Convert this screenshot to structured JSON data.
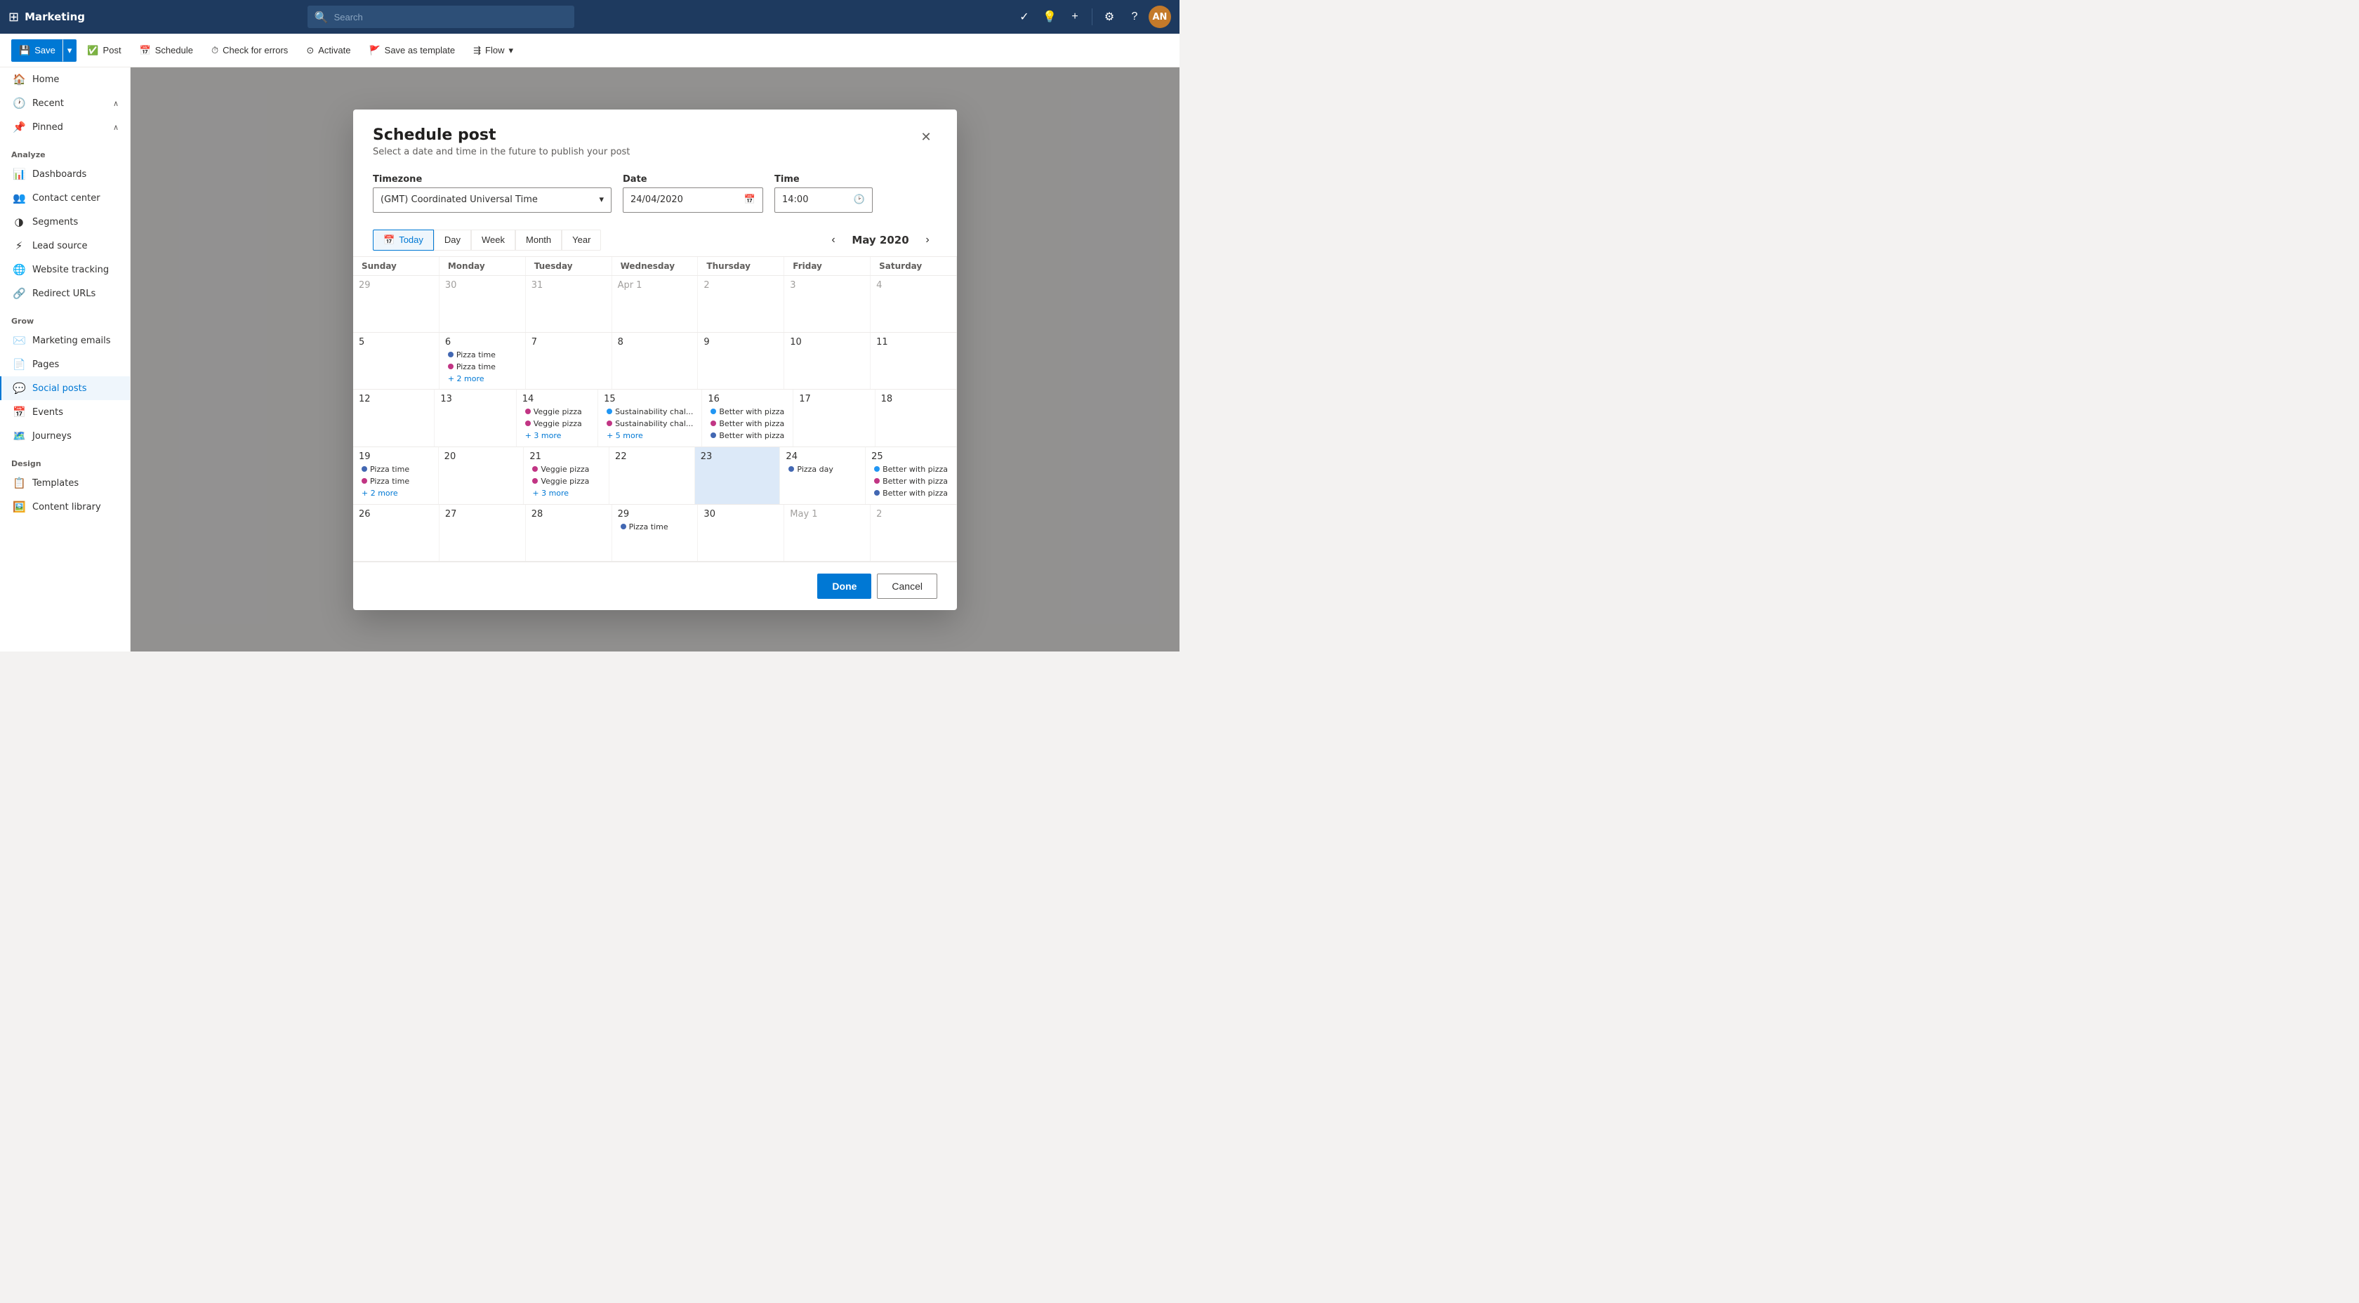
{
  "app": {
    "name": "Marketing",
    "search_placeholder": "Search"
  },
  "toolbar": {
    "save_label": "Save",
    "post_label": "Post",
    "schedule_label": "Schedule",
    "check_errors_label": "Check for errors",
    "activate_label": "Activate",
    "save_template_label": "Save as template",
    "flow_label": "Flow"
  },
  "sidebar": {
    "analyze_label": "Analyze",
    "grow_label": "Grow",
    "design_label": "Design",
    "items": [
      {
        "id": "home",
        "label": "Home",
        "icon": "🏠"
      },
      {
        "id": "recent",
        "label": "Recent",
        "icon": "🕐",
        "has_collapse": true
      },
      {
        "id": "pinned",
        "label": "Pinned",
        "icon": "📌",
        "has_collapse": true
      },
      {
        "id": "dashboards",
        "label": "Dashboards",
        "icon": "📊"
      },
      {
        "id": "contact-center",
        "label": "Contact center",
        "icon": "👥"
      },
      {
        "id": "segments",
        "label": "Segments",
        "icon": "◑"
      },
      {
        "id": "lead-source",
        "label": "Lead source",
        "icon": "⚡"
      },
      {
        "id": "website-tracking",
        "label": "Website tracking",
        "icon": "🌐"
      },
      {
        "id": "redirect-urls",
        "label": "Redirect URLs",
        "icon": "🔗"
      },
      {
        "id": "marketing-emails",
        "label": "Marketing emails",
        "icon": "✉️"
      },
      {
        "id": "pages",
        "label": "Pages",
        "icon": "📄"
      },
      {
        "id": "social-posts",
        "label": "Social posts",
        "icon": "💬",
        "active": true
      },
      {
        "id": "events",
        "label": "Events",
        "icon": "📅"
      },
      {
        "id": "journeys",
        "label": "Journeys",
        "icon": "🗺️"
      },
      {
        "id": "templates",
        "label": "Templates",
        "icon": "📋"
      },
      {
        "id": "content-library",
        "label": "Content library",
        "icon": "🖼️"
      }
    ]
  },
  "modal": {
    "title": "Schedule post",
    "subtitle": "Select a date and time in the future to publish your post",
    "timezone_label": "Timezone",
    "timezone_value": "(GMT) Coordinated Universal Time",
    "date_label": "Date",
    "date_value": "24/04/2020",
    "time_label": "Time",
    "time_value": "14:00",
    "done_label": "Done",
    "cancel_label": "Cancel",
    "calendar_month": "May 2020",
    "views": [
      "Today",
      "Day",
      "Week",
      "Month",
      "Year"
    ],
    "active_view": "Today",
    "day_headers": [
      "Sunday",
      "Monday",
      "Tuesday",
      "Wednesday",
      "Thursday",
      "Friday",
      "Saturday"
    ],
    "weeks": [
      {
        "days": [
          {
            "num": "29",
            "other": true,
            "events": []
          },
          {
            "num": "30",
            "other": true,
            "events": []
          },
          {
            "num": "31",
            "other": true,
            "events": []
          },
          {
            "num": "Apr 1",
            "other": true,
            "events": []
          },
          {
            "num": "2",
            "other": true,
            "events": []
          },
          {
            "num": "3",
            "other": true,
            "events": []
          },
          {
            "num": "4",
            "other": true,
            "events": []
          }
        ]
      },
      {
        "days": [
          {
            "num": "5",
            "events": []
          },
          {
            "num": "6",
            "events": [
              {
                "label": "Pizza time",
                "color": "#737373",
                "platform": "fb"
              },
              {
                "label": "Pizza time",
                "color": "#737373",
                "platform": "ig"
              },
              {
                "label": "+ 2 more",
                "more": true
              }
            ]
          },
          {
            "num": "7",
            "events": []
          },
          {
            "num": "8",
            "events": []
          },
          {
            "num": "9",
            "events": []
          },
          {
            "num": "10",
            "events": []
          },
          {
            "num": "11",
            "events": []
          }
        ]
      },
      {
        "days": [
          {
            "num": "12",
            "events": []
          },
          {
            "num": "13",
            "events": []
          },
          {
            "num": "14",
            "events": [
              {
                "label": "Veggie pizza",
                "color": "#737373",
                "platform": "ig"
              },
              {
                "label": "Veggie pizza",
                "color": "#737373",
                "platform": "ig"
              },
              {
                "label": "+ 3 more",
                "more": true
              }
            ]
          },
          {
            "num": "15",
            "events": [
              {
                "label": "Sustainability chal...",
                "color": "#2196f3",
                "platform": "tw"
              },
              {
                "label": "Sustainability chal...",
                "color": "#2196f3",
                "platform": "ig"
              },
              {
                "label": "+ 5 more",
                "more": true
              }
            ]
          },
          {
            "num": "16",
            "events": [
              {
                "label": "Better with pizza",
                "color": "#2196f3",
                "platform": "tw"
              },
              {
                "label": "Better with pizza",
                "color": "#737373",
                "platform": "ig"
              },
              {
                "label": "Better with pizza",
                "color": "#4267b2",
                "platform": "fb"
              }
            ]
          },
          {
            "num": "17",
            "events": []
          },
          {
            "num": "18",
            "events": []
          }
        ]
      },
      {
        "days": [
          {
            "num": "19",
            "events": [
              {
                "label": "Pizza time",
                "color": "#737373",
                "platform": "fb"
              },
              {
                "label": "Pizza time",
                "color": "#737373",
                "platform": "ig"
              },
              {
                "label": "+ 2 more",
                "more": true
              }
            ]
          },
          {
            "num": "20",
            "events": []
          },
          {
            "num": "21",
            "events": [
              {
                "label": "Veggie pizza",
                "color": "#737373",
                "platform": "ig"
              },
              {
                "label": "Veggie pizza",
                "color": "#737373",
                "platform": "ig"
              },
              {
                "label": "+ 3 more",
                "more": true
              }
            ]
          },
          {
            "num": "22",
            "events": []
          },
          {
            "num": "23",
            "today": true,
            "events": []
          },
          {
            "num": "24",
            "events": [
              {
                "label": "Pizza day",
                "color": "#4267b2",
                "platform": "fb"
              }
            ]
          },
          {
            "num": "25",
            "events": [
              {
                "label": "Better with pizza",
                "color": "#2196f3",
                "platform": "tw"
              },
              {
                "label": "Better with pizza",
                "color": "#737373",
                "platform": "ig"
              },
              {
                "label": "Better with pizza",
                "color": "#4267b2",
                "platform": "fb"
              }
            ]
          }
        ]
      },
      {
        "days": [
          {
            "num": "26",
            "events": []
          },
          {
            "num": "27",
            "events": []
          },
          {
            "num": "28",
            "events": []
          },
          {
            "num": "29",
            "events": [
              {
                "label": "Pizza time",
                "color": "#4267b2",
                "platform": "fb"
              }
            ]
          },
          {
            "num": "30",
            "events": []
          },
          {
            "num": "May 1",
            "other": true,
            "events": []
          },
          {
            "num": "2",
            "other": true,
            "events": []
          }
        ]
      }
    ]
  },
  "platform_colors": {
    "tw": "#2196f3",
    "ig": "#c13584",
    "fb": "#4267b2"
  }
}
